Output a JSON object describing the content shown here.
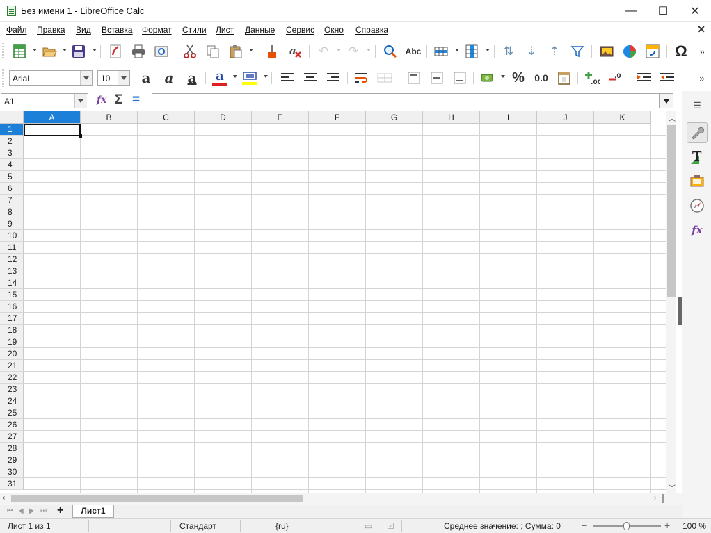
{
  "window": {
    "title": "Без имени 1 - LibreOffice Calc",
    "min_glyph": "—",
    "max_glyph": "☐",
    "close_glyph": "✕"
  },
  "menu": [
    "Файл",
    "Правка",
    "Вид",
    "Вставка",
    "Формат",
    "Стили",
    "Лист",
    "Данные",
    "Сервис",
    "Окно",
    "Справка"
  ],
  "doc_close_glyph": "✕",
  "toolbar_icons": {
    "new": "new-spreadsheet-icon",
    "open": "open-folder-icon",
    "save": "save-icon",
    "export_pdf": "export-pdf-icon",
    "print": "print-icon",
    "print_preview": "print-preview-icon",
    "cut": "cut-icon",
    "copy": "copy-icon",
    "paste": "paste-icon",
    "clone": "clone-formatting-icon",
    "clear": "clear-formatting-icon",
    "undo": "undo-icon",
    "redo": "redo-icon",
    "find": "find-replace-icon",
    "spelling": "spelling-icon",
    "row": "row-icon",
    "column": "column-icon",
    "sort": "sort-icon",
    "sort_asc": "sort-ascending-icon",
    "sort_desc": "sort-descending-icon",
    "autofilter": "autofilter-icon",
    "image": "image-icon",
    "chart": "chart-icon",
    "pivot": "pivot-table-icon",
    "special_char": "special-character-icon"
  },
  "toolbar1_text": {
    "spelling": "Abc",
    "special_char": "Ω"
  },
  "format": {
    "font_name": "Arial",
    "font_size": "10",
    "bold": "a",
    "italic": "a",
    "underline": "a",
    "font_color_letter": "a",
    "font_color": "#e02020",
    "highlight_color": "#ffff00",
    "percent": "%",
    "decimal": "0.0"
  },
  "formula_bar": {
    "name_box": "A1",
    "function_wizard": "fx",
    "sum": "Σ",
    "equals": "="
  },
  "columns": [
    "A",
    "B",
    "C",
    "D",
    "E",
    "F",
    "G",
    "H",
    "I",
    "J",
    "K"
  ],
  "rows": [
    "1",
    "2",
    "3",
    "4",
    "5",
    "6",
    "7",
    "8",
    "9",
    "10",
    "11",
    "12",
    "13",
    "14",
    "15",
    "16",
    "17",
    "18",
    "19",
    "20",
    "21",
    "22",
    "23",
    "24",
    "25",
    "26",
    "27",
    "28",
    "29",
    "30",
    "31"
  ],
  "selection": {
    "column": "A",
    "row": "1"
  },
  "sheet_tab": "Лист1",
  "add_sheet": "+",
  "status": {
    "sheet": "Лист 1 из 1",
    "page_style": "Стандарт",
    "language": "{ru}",
    "sum": "Среднее значение: ; Сумма: 0",
    "zoom": "100 %"
  },
  "sidebar_icons": [
    "sidebar-menu-icon",
    "properties-icon",
    "styles-icon",
    "gallery-icon",
    "navigator-icon",
    "functions-icon"
  ],
  "colors": {
    "selection": "#1c7fd8",
    "grid": "#d4d4d4",
    "header_bg": "#f0f0f0"
  }
}
